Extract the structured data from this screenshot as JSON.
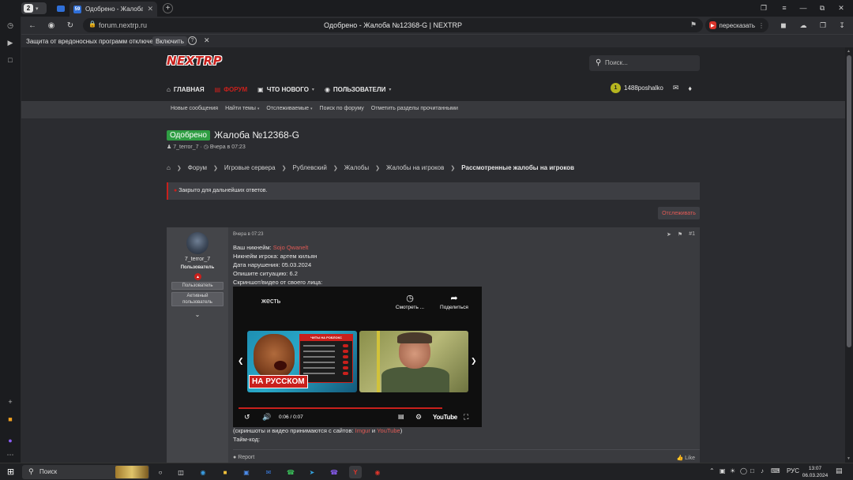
{
  "browser": {
    "tab_count": "2",
    "active_tab_title": "Одобрено - Жалоба №",
    "url_domain": "forum.nextrp.ru",
    "page_title": "Одобрено - Жалоба №12368-G | NEXTRP",
    "share_label": "пересказать",
    "protection_text": "Защита от вредоносных программ отключена",
    "protection_enable": "Включить"
  },
  "site": {
    "logo": "NEXTRP",
    "search_placeholder": "Поиск...",
    "nav": [
      {
        "label": "ГЛАВНАЯ"
      },
      {
        "label": "ФОРУМ"
      },
      {
        "label": "ЧТО НОВОГО"
      },
      {
        "label": "ПОЛЬЗОВАТЕЛИ"
      }
    ],
    "user": {
      "badge": "1",
      "name": "1488poshalko"
    },
    "subnav": [
      "Новые сообщения",
      "Найти темы",
      "Отслеживаемые",
      "Поиск по форуму",
      "Отметить разделы прочитанными"
    ]
  },
  "thread": {
    "badge": "Одобрено",
    "title": "Жалоба №12368-G",
    "author": "7_terror_7",
    "date": "Вчера в 07:23",
    "breadcrumb": [
      "Форум",
      "Игровые сервера",
      "Рублевский",
      "Жалобы",
      "Жалобы на игроков",
      "Рассмотренные жалобы на игроков"
    ],
    "closed_notice": "Закрыто для дальнейших ответов.",
    "watch_label": "Отслеживать"
  },
  "post": {
    "author": "7_terror_7",
    "role": "Пользователь",
    "badges": [
      "Пользователь",
      "Активный пользователь"
    ],
    "date": "Вчера в 07:23",
    "number": "#1",
    "lines": {
      "nickname_label": "Ваш никнейм:",
      "nickname_value": "Sojo Qwanelt",
      "player_nickname": "Никнейм игрока: артем кильян",
      "violation_date": "Дата нарушения: 05.03.2024",
      "situation": "Опишите ситуацию: 6.2",
      "screenshot_label": "Скриншот/видео от своего лица:",
      "sites_prefix": "(скриншоты и видео принимаются с сайтов:",
      "site1": "Imgur",
      "sites_and": "и",
      "site2": "YouTube",
      "sites_suffix": ")",
      "timecode": "Тайм-код:"
    },
    "video": {
      "title": "жесть",
      "watch_later": "Смотреть ...",
      "share": "Поделиться",
      "thumb_caption": "НА РУССКОМ",
      "thumb_menu_title": "ЧИТЫ НА РОБЛОКС",
      "time": "0:06 / 0:07",
      "logo": "YouTube",
      "progress": 0.857
    },
    "report": "Report",
    "like": "Like"
  },
  "taskbar": {
    "search_placeholder": "Поиск",
    "lang": "РУС",
    "time": "13:07",
    "date": "06.03.2024"
  },
  "colors": {
    "accent_red": "#c9201c",
    "approved_green": "#2f9e43",
    "user_badge_yellow": "#b5b51f"
  }
}
